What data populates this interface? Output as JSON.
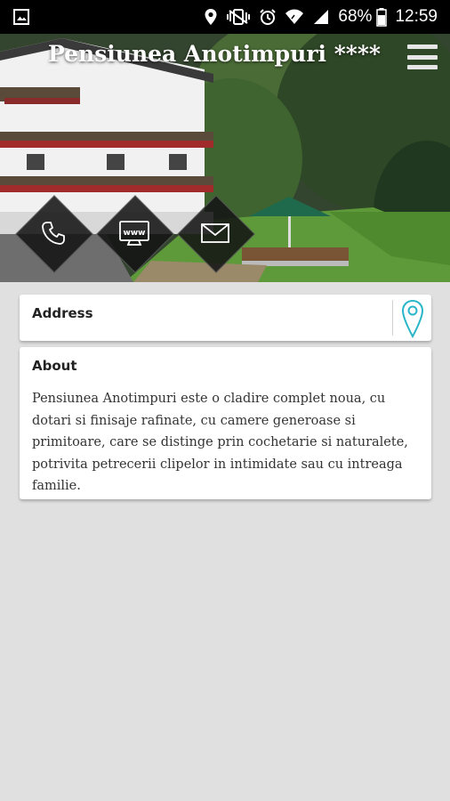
{
  "status_bar": {
    "battery": "68%",
    "time": "12:59",
    "icons": [
      "gallery-icon",
      "location-icon",
      "vibrate-icon",
      "alarm-icon",
      "wifi-icon",
      "signal-icon",
      "battery-icon"
    ]
  },
  "header": {
    "title": "Pensiunea Anotimpuri ****",
    "menu_icon": "hamburger-menu-icon",
    "actions": [
      {
        "name": "call-button",
        "icon": "phone-icon"
      },
      {
        "name": "website-button",
        "icon": "www-icon",
        "label": "www"
      },
      {
        "name": "email-button",
        "icon": "mail-icon"
      }
    ]
  },
  "address": {
    "label": "Address",
    "map_icon": "map-pin-icon",
    "accent_color": "#29b6c8"
  },
  "about": {
    "label": "About",
    "text": "Pensiunea Anotimpuri este o cladire complet noua, cu dotari si finisaje rafinate, cu camere generoase si primitoare, care se distinge prin cochetarie si naturalete, potrivita petrecerii clipelor in intimidate sau cu intreaga familie."
  }
}
